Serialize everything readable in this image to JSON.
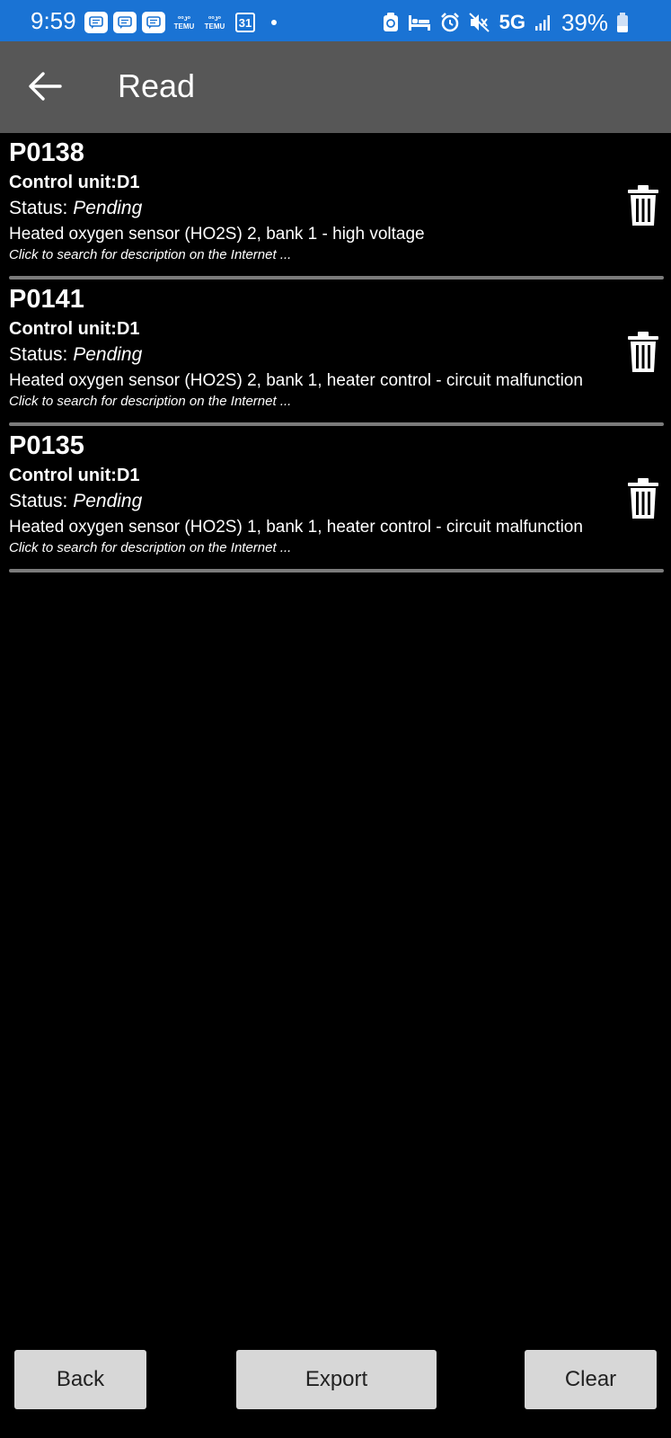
{
  "status_bar": {
    "time": "9:59",
    "notifications": [
      {
        "icon": "message-icon"
      },
      {
        "icon": "message-icon"
      },
      {
        "icon": "message-icon"
      },
      {
        "icon": "temu-icon",
        "line1": "ᵒᵒᴊᵒ",
        "line2": "TEMU"
      },
      {
        "icon": "temu-icon",
        "line1": "ᵒᵒᴊᵒ",
        "line2": "TEMU"
      },
      {
        "icon": "calendar-icon",
        "label": "31"
      }
    ],
    "network": "5G",
    "battery": "39%",
    "battery_level": 0.39
  },
  "app_bar": {
    "title": "Read"
  },
  "codes": [
    {
      "code": "P0138",
      "control_unit": "Control unit:D1",
      "status_prefix": "Status: ",
      "status_value": "Pending",
      "description": "Heated oxygen sensor (HO2S) 2, bank 1 - high voltage",
      "hint": "Click to search for description on the Internet ..."
    },
    {
      "code": "P0141",
      "control_unit": "Control unit:D1",
      "status_prefix": "Status: ",
      "status_value": "Pending",
      "description": "Heated oxygen sensor (HO2S) 2, bank 1, heater control - circuit malfunction",
      "hint": "Click to search for description on the Internet ..."
    },
    {
      "code": "P0135",
      "control_unit": "Control unit:D1",
      "status_prefix": "Status: ",
      "status_value": "Pending",
      "description": "Heated oxygen sensor (HO2S) 1, bank 1, heater control - circuit malfunction",
      "hint": "Click to search for description on the Internet ..."
    }
  ],
  "buttons": {
    "back": "Back",
    "export": "Export",
    "clear": "Clear"
  },
  "colors": {
    "status_bar": "#1a73d4",
    "app_bar": "#575757",
    "background": "#000000",
    "button": "#d7d7d7"
  }
}
